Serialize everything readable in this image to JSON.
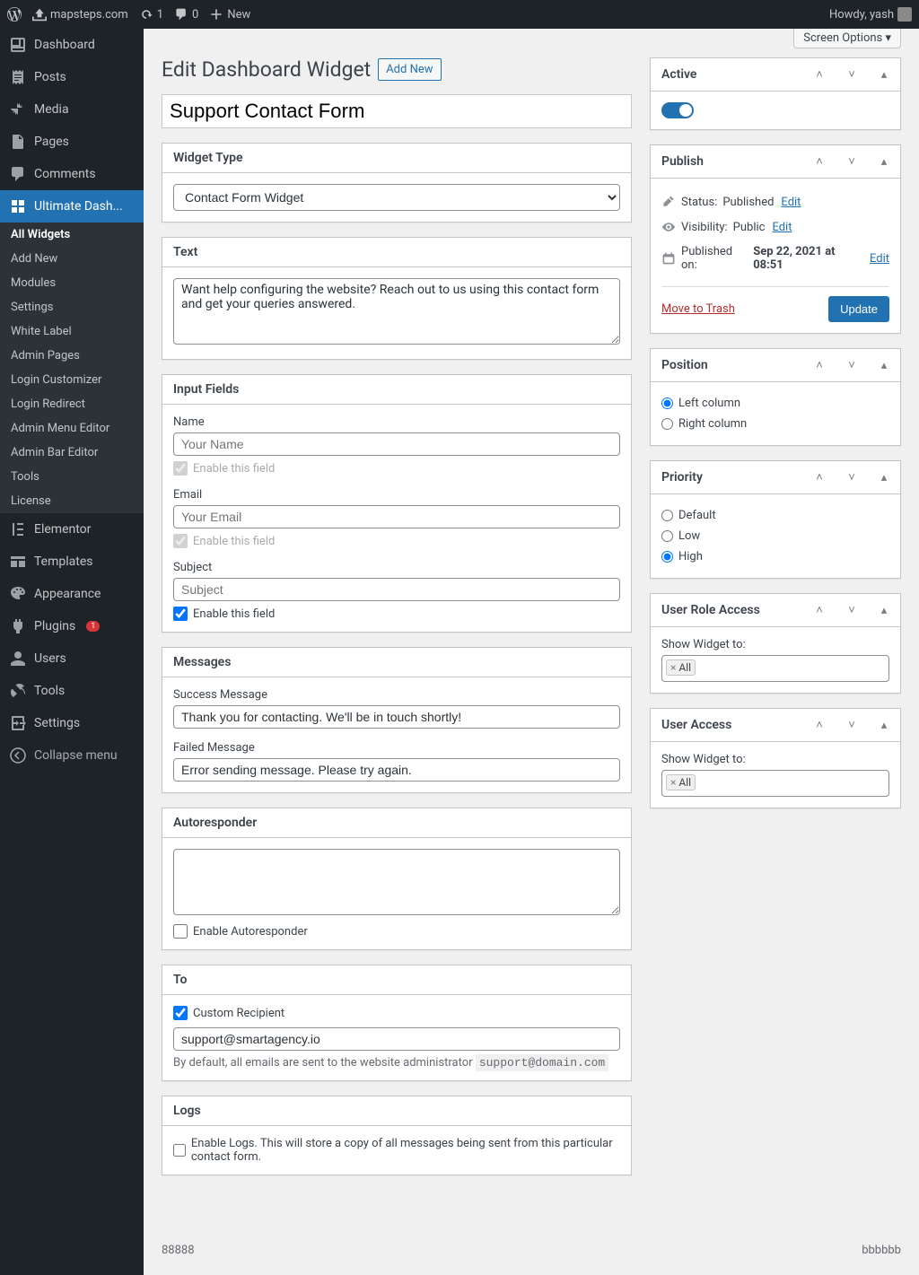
{
  "adminBar": {
    "siteName": "mapsteps.com",
    "updates": "1",
    "comments": "0",
    "new": "New",
    "howdy": "Howdy, yash"
  },
  "screenOptions": "Screen Options",
  "sidebar": {
    "dashboard": "Dashboard",
    "posts": "Posts",
    "media": "Media",
    "pages": "Pages",
    "comments": "Comments",
    "ultimateDash": "Ultimate Dash...",
    "submenu": {
      "allWidgets": "All Widgets",
      "addNew": "Add New",
      "modules": "Modules",
      "settings": "Settings",
      "whiteLabel": "White Label",
      "adminPages": "Admin Pages",
      "loginCustomizer": "Login Customizer",
      "loginRedirect": "Login Redirect",
      "adminMenuEditor": "Admin Menu Editor",
      "adminBarEditor": "Admin Bar Editor",
      "tools": "Tools",
      "license": "License"
    },
    "elementor": "Elementor",
    "templates": "Templates",
    "appearance": "Appearance",
    "plugins": "Plugins",
    "pluginsBadge": "1",
    "users": "Users",
    "tools": "Tools",
    "settings": "Settings",
    "collapse": "Collapse menu"
  },
  "pageTitle": "Edit Dashboard Widget",
  "addNewBtn": "Add New",
  "postTitle": "Support Contact Form",
  "widgetType": {
    "heading": "Widget Type",
    "value": "Contact Form Widget"
  },
  "text": {
    "heading": "Text",
    "value": "Want help configuring the website? Reach out to us using this contact form and get your queries answered."
  },
  "inputFields": {
    "heading": "Input Fields",
    "nameLabel": "Name",
    "namePlaceholder": "Your Name",
    "emailLabel": "Email",
    "emailPlaceholder": "Your Email",
    "subjectLabel": "Subject",
    "subjectPlaceholder": "Subject",
    "enableField": "Enable this field"
  },
  "messages": {
    "heading": "Messages",
    "successLabel": "Success Message",
    "successValue": "Thank you for contacting. We'll be in touch shortly!",
    "failedLabel": "Failed Message",
    "failedValue": "Error sending message. Please try again."
  },
  "autoresponder": {
    "heading": "Autoresponder",
    "enable": "Enable Autoresponder"
  },
  "to": {
    "heading": "To",
    "customRecipient": "Custom Recipient",
    "value": "support@smartagency.io",
    "description": "By default, all emails are sent to the website administrator",
    "defaultEmail": "support@domain.com"
  },
  "logs": {
    "heading": "Logs",
    "enable": "Enable Logs. This will store a copy of all messages being sent from this particular contact form."
  },
  "active": {
    "heading": "Active"
  },
  "publish": {
    "heading": "Publish",
    "statusLabel": "Status:",
    "statusValue": "Published",
    "visibilityLabel": "Visibility:",
    "visibilityValue": "Public",
    "publishedLabel": "Published on:",
    "publishedValue": "Sep 22, 2021 at 08:51",
    "edit": "Edit",
    "trash": "Move to Trash",
    "update": "Update"
  },
  "position": {
    "heading": "Position",
    "left": "Left column",
    "right": "Right column"
  },
  "priority": {
    "heading": "Priority",
    "default": "Default",
    "low": "Low",
    "high": "High"
  },
  "userRoleAccess": {
    "heading": "User Role Access",
    "showTo": "Show Widget to:",
    "all": "All"
  },
  "userAccess": {
    "heading": "User Access",
    "showTo": "Show Widget to:",
    "all": "All"
  },
  "footer": {
    "left": "88888",
    "right": "bbbbbb"
  }
}
